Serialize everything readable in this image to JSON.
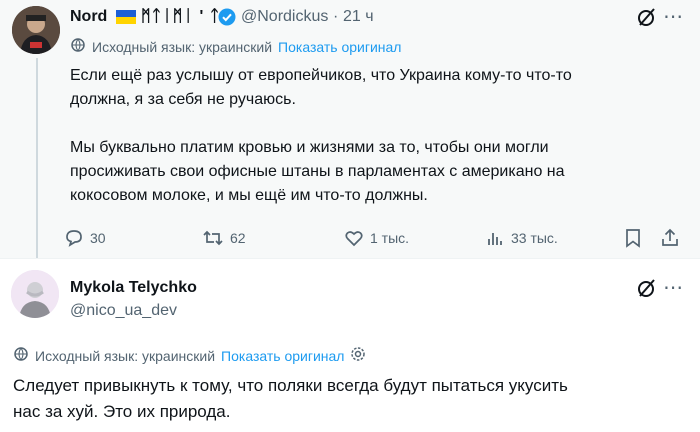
{
  "tweet1": {
    "author_name": "Nord",
    "author_runes": "ᛗᛏᛁᛗᛁ ' ᛏ",
    "handle": "@Nordickus",
    "time": "21 ч",
    "translate_lang": "Исходный язык: украинский",
    "translate_link": "Показать оригинал",
    "paragraph1": "Если ещё раз услышу от европейчиков, что Украина кому-то что-то\nдолжна, я за себя не ручаюсь.",
    "paragraph2": "Мы буквально платим кровью и жизнями за то, чтобы они могли\nпросиживать свои офисные штаны в парламентах с американо на\nкокосовом молоке, и мы ещё им что-то должны.",
    "replies": "30",
    "reposts": "62",
    "likes": "1 тыс.",
    "views": "33 тыс."
  },
  "tweet2": {
    "author_name": "Mykola Telychko",
    "handle": "@nico_ua_dev",
    "translate_lang": "Исходный язык: украинский",
    "translate_link": "Показать оригинал",
    "text": "Следует привыкнуть к тому, что поляки всегда будут пытаться укусить\nнас за хуй. Это их природа."
  },
  "colors": {
    "link": "#1d9bf0",
    "secondary": "#536471",
    "verified": "#1d9bf0"
  }
}
